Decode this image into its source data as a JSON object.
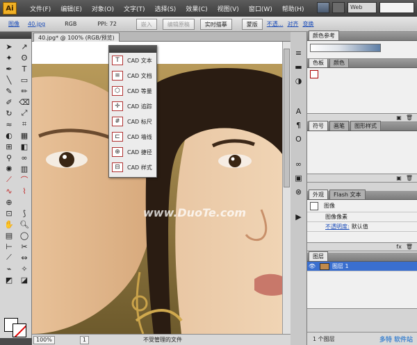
{
  "app": {
    "logo": "Ai"
  },
  "menu": [
    "文件(F)",
    "编辑(E)",
    "对象(O)",
    "文字(T)",
    "选择(S)",
    "效果(C)",
    "视图(V)",
    "窗口(W)",
    "帮助(H)"
  ],
  "workspace": "Web",
  "controlbar": {
    "type_label": "图像",
    "file_name": "40.jpg",
    "color_mode": "RGB",
    "ppi": "PPI: 72",
    "embed": "嵌入",
    "edit_original": "编辑原稿",
    "live_trace": "实时描摹",
    "mask": "蒙版",
    "opacity": "不透...",
    "align": "对齐",
    "transform": "变换"
  },
  "document": {
    "tab": "40.jpg* @ 100% (RGB/预览)",
    "watermark": "www.DuoTe.com"
  },
  "status": {
    "zoom": "100%",
    "page": "1",
    "text": "不受管理的文件"
  },
  "cad_panel": {
    "items": [
      {
        "icon": "T",
        "label": "CAD 文本"
      },
      {
        "icon": "≡",
        "label": "CAD 文档"
      },
      {
        "icon": "⬡",
        "label": "CAD 等量"
      },
      {
        "icon": "✛",
        "label": "CAD 追踪"
      },
      {
        "icon": "#",
        "label": "CAD 标尺"
      },
      {
        "icon": "⊏",
        "label": "CAD 墙线"
      },
      {
        "icon": "⊕",
        "label": "CAD 捷径"
      },
      {
        "icon": "⊟",
        "label": "CAD 样式"
      }
    ]
  },
  "panels": {
    "color_guide": {
      "title": "颜色参考"
    },
    "swatches": {
      "tabs": [
        "色板",
        "颜色"
      ]
    },
    "symbols": {
      "tabs": [
        "符号",
        "画笔",
        "图形样式"
      ]
    },
    "appearance": {
      "tabs": [
        "外观",
        "Flash 文本"
      ],
      "object": "图像",
      "row1": "图像像素",
      "opacity_label": "不透明度:",
      "opacity_value": "默认值"
    },
    "layers": {
      "tab": "图层",
      "layer_name": "图层 1",
      "footer": "1 个图层"
    }
  },
  "watermark_site": "DuoTe.com",
  "watermark_brand": "多特 软件站"
}
